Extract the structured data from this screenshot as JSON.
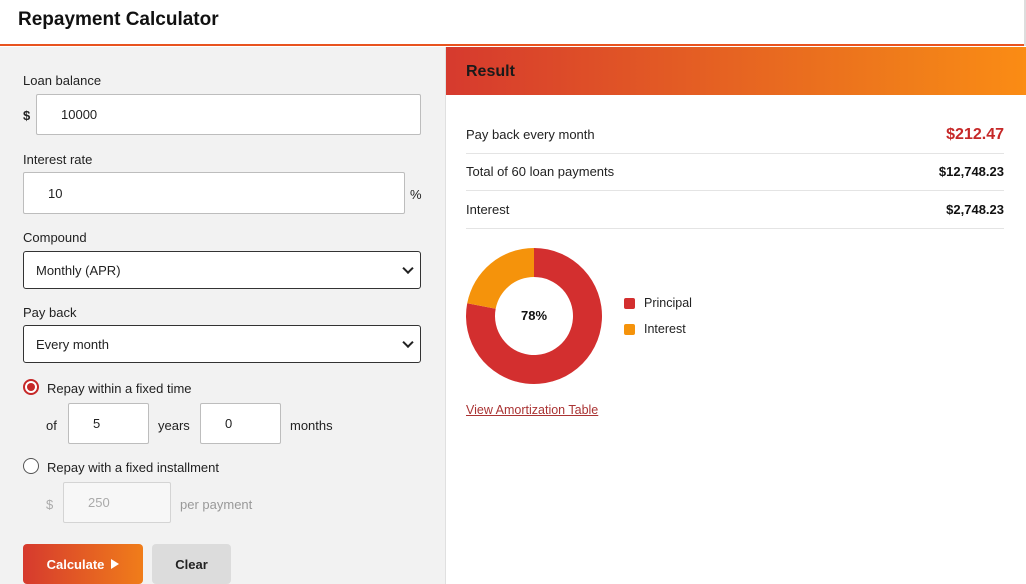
{
  "app": {
    "title": "Repayment Calculator"
  },
  "form": {
    "loan_balance_label": "Loan balance",
    "currency_symbol": "$",
    "loan_balance_value": "10000",
    "interest_rate_label": "Interest rate",
    "interest_rate_value": "10",
    "percent_symbol": "%",
    "compound_label": "Compound",
    "compound_value": "Monthly (APR)",
    "payback_label": "Pay back",
    "payback_value": "Every month",
    "option_fixed_time_label": "Repay within a fixed time",
    "option_fixed_time_selected": true,
    "of_label": "of",
    "years_value": "5",
    "years_label": "years",
    "months_value": "0",
    "months_label": "months",
    "option_fixed_installment_label": "Repay with a fixed installment",
    "installment_currency": "$",
    "installment_value": "250",
    "per_payment_label": "per payment",
    "calculate_label": "Calculate",
    "clear_label": "Clear"
  },
  "result": {
    "header": "Result",
    "rows": [
      {
        "label": "Pay back every month",
        "value": "$212.47"
      },
      {
        "label": "Total of 60 loan payments",
        "value": "$12,748.23"
      },
      {
        "label": "Interest",
        "value": "$2,748.23"
      }
    ],
    "donut_center_label": "78%",
    "legend": [
      {
        "name": "Principal",
        "color": "#d32f2f"
      },
      {
        "name": "Interest",
        "color": "#f5930b"
      }
    ],
    "amortization_link": "View Amortization Table"
  },
  "chart_data": {
    "type": "pie",
    "categories": [
      "Principal",
      "Interest"
    ],
    "values": [
      78,
      22
    ],
    "colors": [
      "#d32f2f",
      "#f5930b"
    ]
  }
}
